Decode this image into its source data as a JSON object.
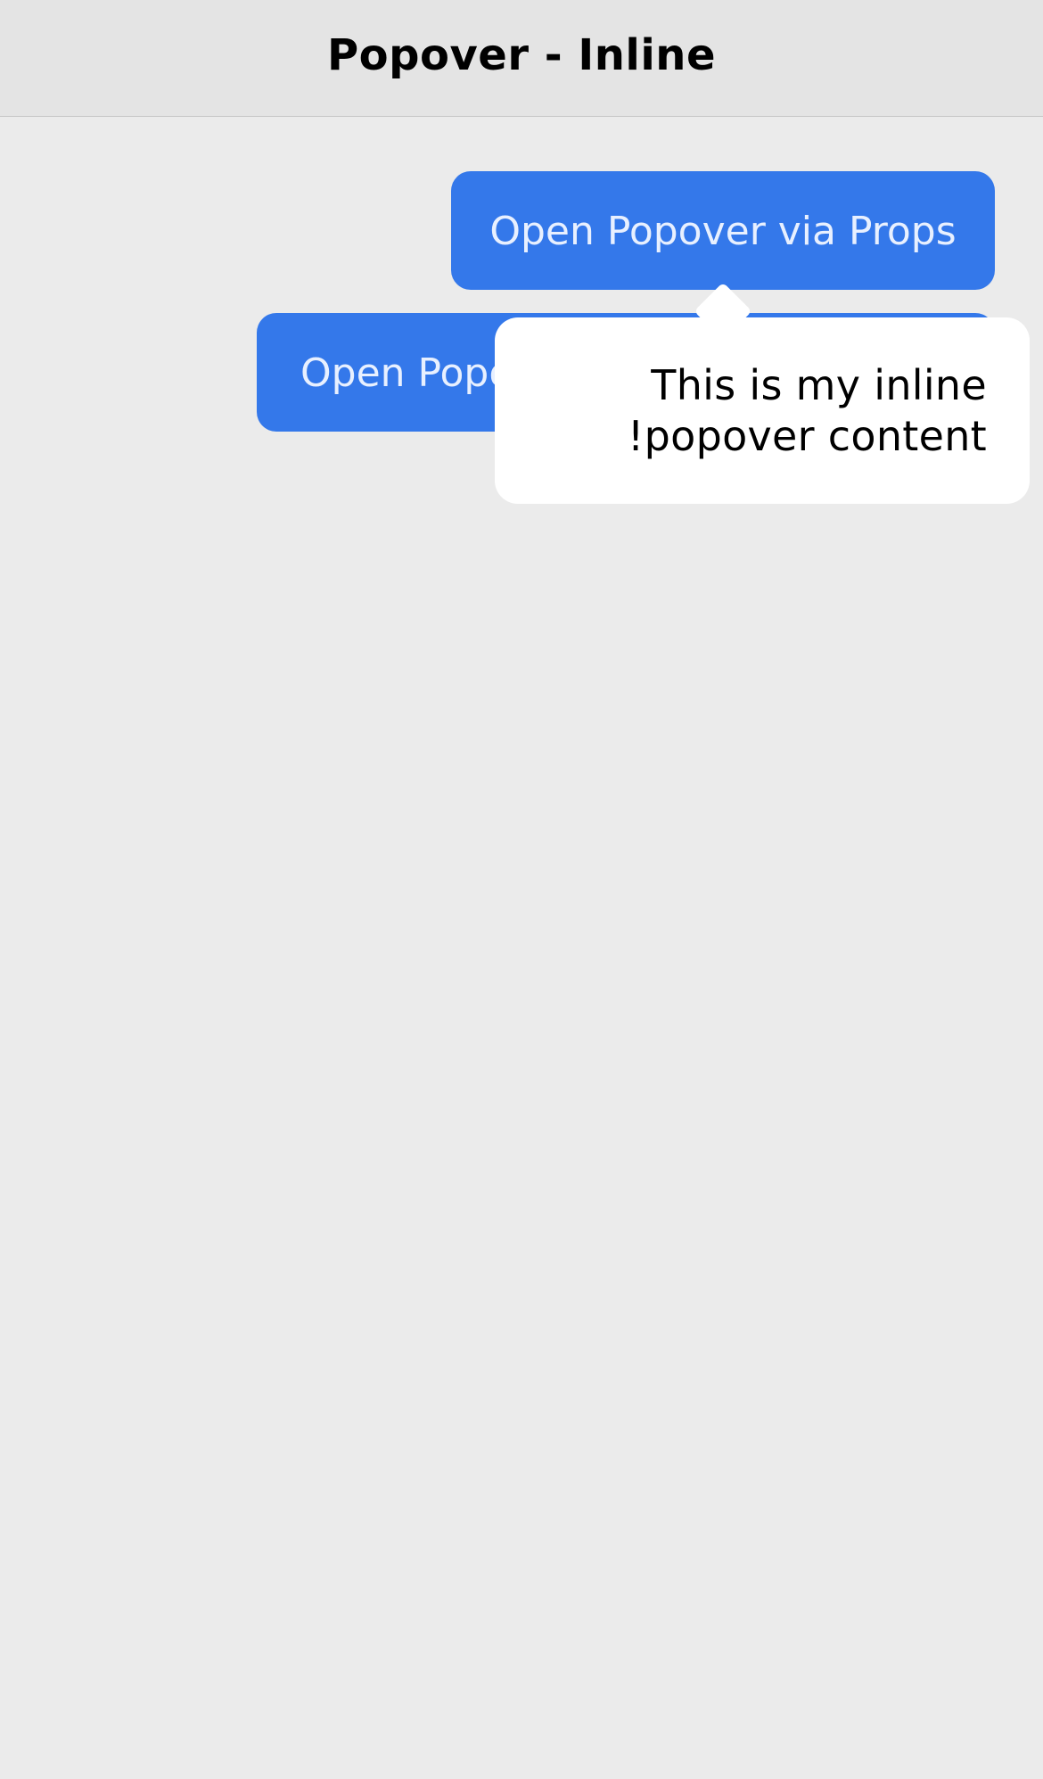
{
  "header": {
    "title": "Popover - Inline"
  },
  "buttons": {
    "open_via_props": "Open Popover via Props",
    "open_inline_visible": "Open Popo"
  },
  "popover": {
    "content": "This is my inline popover content!"
  },
  "colors": {
    "background": "#ebebeb",
    "header_background": "#e4e4e4",
    "button_primary": "#3478ea",
    "popover_background": "#ffffff"
  }
}
